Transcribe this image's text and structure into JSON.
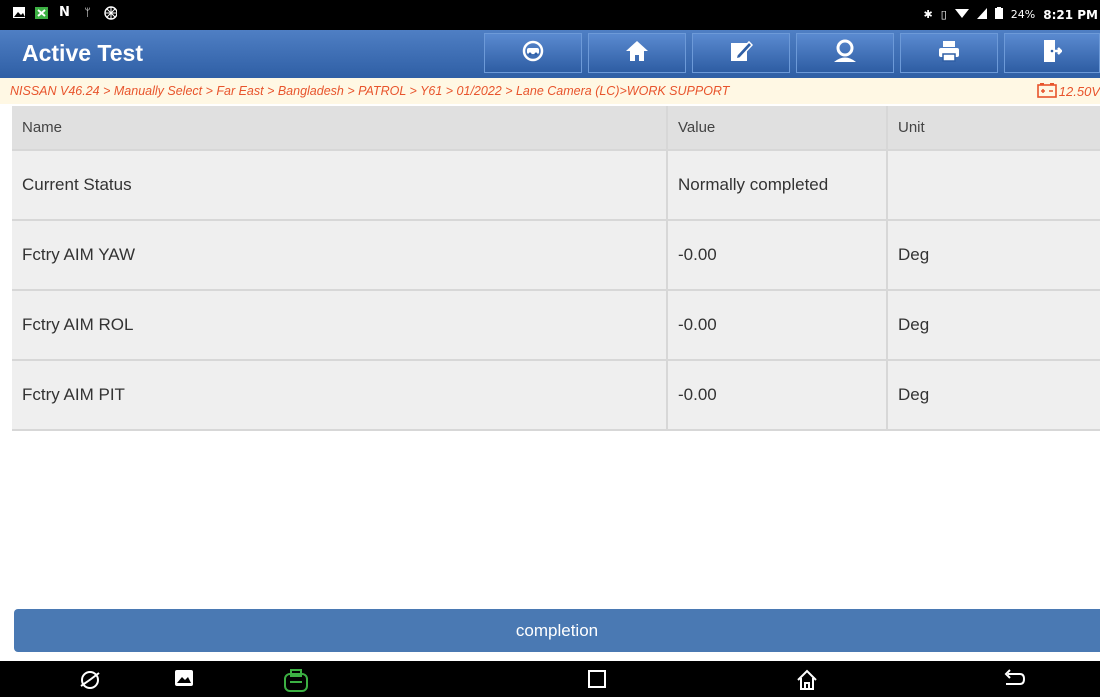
{
  "status_bar": {
    "left_icons": [
      "image-icon",
      "app-icon",
      "n-icon",
      "usb-icon",
      "shutter-icon"
    ],
    "right_icons": [
      "bluetooth-icon",
      "vibrate-icon",
      "wifi-icon",
      "signal-icon",
      "battery-icon"
    ],
    "battery_percent": "24%",
    "time": "8:21 PM"
  },
  "header": {
    "title": "Active Test",
    "buttons": [
      {
        "name": "vehicle-menu-icon"
      },
      {
        "name": "home-icon"
      },
      {
        "name": "edit-icon"
      },
      {
        "name": "user-icon"
      },
      {
        "name": "print-icon"
      },
      {
        "name": "exit-icon"
      }
    ]
  },
  "breadcrumb": {
    "path": "NISSAN V46.24 > Manually Select > Far East > Bangladesh > PATROL > Y61 > 01/2022 > Lane Camera (LC)>WORK SUPPORT",
    "voltage": "12.50V"
  },
  "table": {
    "columns": [
      "Name",
      "Value",
      "Unit"
    ],
    "rows": [
      {
        "name": "Current Status",
        "value": "Normally completed",
        "unit": ""
      },
      {
        "name": "Fctry AIM YAW",
        "value": "-0.00",
        "unit": "Deg"
      },
      {
        "name": "Fctry AIM ROL",
        "value": "-0.00",
        "unit": "Deg"
      },
      {
        "name": "Fctry AIM PIT",
        "value": "-0.00",
        "unit": "Deg"
      }
    ]
  },
  "completion_button": "completion",
  "navbar": {
    "icons": [
      "browser-icon",
      "gallery-icon",
      "vci-icon",
      "recents-icon",
      "home-nav-icon",
      "back-icon"
    ]
  },
  "colors": {
    "header": "#3a6bb3",
    "breadcrumb_text": "#e8542c",
    "completion": "#4a79b3"
  }
}
